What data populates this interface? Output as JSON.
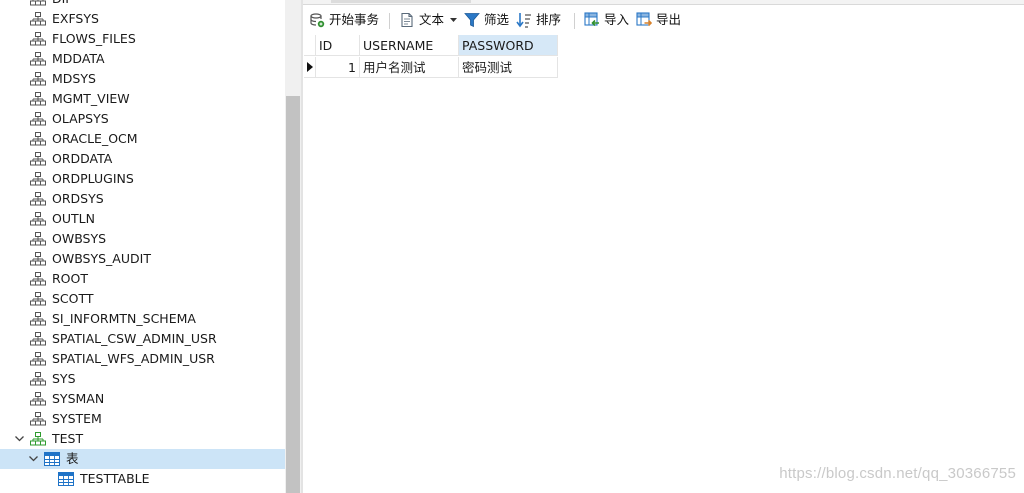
{
  "tree": {
    "items": [
      {
        "label": "DIP",
        "icon": "schema-icon",
        "level": 1
      },
      {
        "label": "EXFSYS",
        "icon": "schema-icon",
        "level": 1
      },
      {
        "label": "FLOWS_FILES",
        "icon": "schema-icon",
        "level": 1
      },
      {
        "label": "MDDATA",
        "icon": "schema-icon",
        "level": 1
      },
      {
        "label": "MDSYS",
        "icon": "schema-icon",
        "level": 1
      },
      {
        "label": "MGMT_VIEW",
        "icon": "schema-icon",
        "level": 1
      },
      {
        "label": "OLAPSYS",
        "icon": "schema-icon",
        "level": 1
      },
      {
        "label": "ORACLE_OCM",
        "icon": "schema-icon",
        "level": 1
      },
      {
        "label": "ORDDATA",
        "icon": "schema-icon",
        "level": 1
      },
      {
        "label": "ORDPLUGINS",
        "icon": "schema-icon",
        "level": 1
      },
      {
        "label": "ORDSYS",
        "icon": "schema-icon",
        "level": 1
      },
      {
        "label": "OUTLN",
        "icon": "schema-icon",
        "level": 1
      },
      {
        "label": "OWBSYS",
        "icon": "schema-icon",
        "level": 1
      },
      {
        "label": "OWBSYS_AUDIT",
        "icon": "schema-icon",
        "level": 1
      },
      {
        "label": "ROOT",
        "icon": "schema-icon",
        "level": 1
      },
      {
        "label": "SCOTT",
        "icon": "schema-icon",
        "level": 1
      },
      {
        "label": "SI_INFORMTN_SCHEMA",
        "icon": "schema-icon",
        "level": 1
      },
      {
        "label": "SPATIAL_CSW_ADMIN_USR",
        "icon": "schema-icon",
        "level": 1
      },
      {
        "label": "SPATIAL_WFS_ADMIN_USR",
        "icon": "schema-icon",
        "level": 1
      },
      {
        "label": "SYS",
        "icon": "schema-icon",
        "level": 1
      },
      {
        "label": "SYSMAN",
        "icon": "schema-icon",
        "level": 1
      },
      {
        "label": "SYSTEM",
        "icon": "schema-icon",
        "level": 1
      },
      {
        "label": "TEST",
        "icon": "schema-open-icon",
        "level": 1,
        "expanded": true
      },
      {
        "label": "表",
        "icon": "tables-folder-icon",
        "level": 2,
        "expanded": true,
        "selected": true
      },
      {
        "label": "TESTTABLE",
        "icon": "table-icon",
        "level": 3
      }
    ]
  },
  "toolbar": {
    "begin_transaction": "开始事务",
    "text": "文本",
    "filter": "筛选",
    "sort": "排序",
    "import": "导入",
    "export": "导出"
  },
  "grid": {
    "columns": [
      "ID",
      "USERNAME",
      "PASSWORD"
    ],
    "active_column": "PASSWORD",
    "rows": [
      {
        "ID": "1",
        "USERNAME": "用户名测试",
        "PASSWORD": "密码测试"
      }
    ]
  },
  "watermark": "https://blog.csdn.net/qq_30366755",
  "colors": {
    "selection": "#cce4f7",
    "header_active": "#d6e8f7",
    "schema_icon": "#555555",
    "schema_open_icon": "#2e9b2e",
    "table_icon": "#1f73c7"
  }
}
